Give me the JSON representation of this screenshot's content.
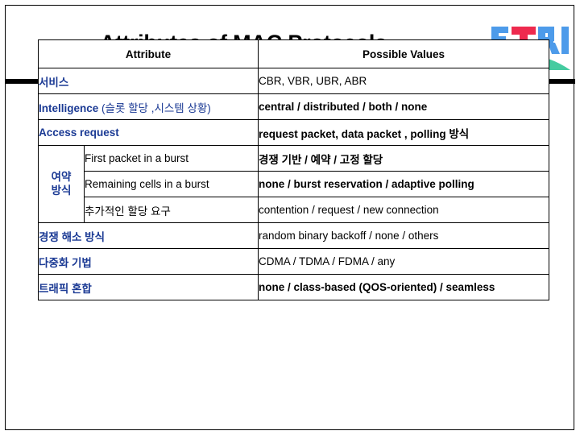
{
  "slide": {
    "title": "Attributes of MAC Protocols",
    "logo": {
      "name": "etri-logo",
      "text": "ETRI",
      "letter_color": "#4d9bea",
      "accent_color": "#ee2a4e",
      "hill_color": "#45cba0"
    },
    "accent_rule_color": "#000000",
    "link_text_color": "#1b3a94"
  },
  "table": {
    "headers": {
      "attribute": "Attribute",
      "possible_values": "Possible Values"
    },
    "rows": [
      {
        "attribute": "서비스",
        "attribute_paren": "",
        "value": "CBR, VBR, UBR, ABR",
        "value_weight": "plain"
      },
      {
        "attribute": "Intelligence",
        "attribute_paren": " (슬롯 할당 ,시스템 상황)",
        "value": "central / distributed / both / none",
        "value_weight": "bold"
      },
      {
        "attribute": "Access request",
        "attribute_paren": "",
        "value": "request packet, data packet , polling 방식",
        "value_weight": "bold"
      }
    ],
    "merged_group": {
      "label_line1": "여약",
      "label_line2": "방식",
      "sub_rows": [
        {
          "sub": "First packet in a burst",
          "sub_lang": "en",
          "value": "경쟁 기반 / 예약 / 고정 할당",
          "value_weight": "bold"
        },
        {
          "sub": "Remaining cells in a burst",
          "sub_lang": "en",
          "value": "none / burst reservation / adaptive polling",
          "value_weight": "bold"
        },
        {
          "sub": "추가적인 할당 요구",
          "sub_lang": "ko",
          "value": "contention / request / new connection",
          "value_weight": "plain"
        }
      ]
    },
    "tail_rows": [
      {
        "attribute": "경쟁 해소 방식",
        "attribute_paren": "",
        "value": "random binary backoff / none / others",
        "value_weight": "plain"
      },
      {
        "attribute": "다중화 기법",
        "attribute_paren": "",
        "value": "CDMA / TDMA / FDMA / any",
        "value_weight": "plain"
      },
      {
        "attribute": "트래픽 혼합",
        "attribute_paren": "",
        "value": "none / class-based (QOS-oriented) / seamless",
        "value_weight": "bold"
      }
    ]
  }
}
